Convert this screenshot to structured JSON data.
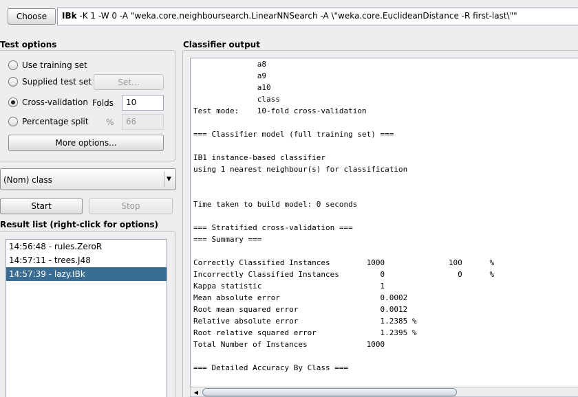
{
  "header": {
    "choose_label": "Choose",
    "command_name": "IBk",
    "command_args": "-K 1 -W 0 -A \"weka.core.neighboursearch.LinearNNSearch -A \\\"weka.core.EuclideanDistance -R first-last\\\"\""
  },
  "test_options": {
    "title": "Test options",
    "use_training_set": "Use training set",
    "supplied_test_set": "Supplied test set",
    "set_label": "Set...",
    "cross_validation": "Cross-validation",
    "folds_label": "Folds",
    "folds_value": "10",
    "percentage_split": "Percentage split",
    "percent_symbol": "%",
    "percentage_value": "66",
    "more_options": "More options...",
    "selected": "cross-validation"
  },
  "class_select": {
    "value": "(Nom) class",
    "arrow": "▼"
  },
  "run": {
    "start_label": "Start",
    "stop_label": "Stop"
  },
  "result_list": {
    "title": "Result list (right-click for options)",
    "items": [
      {
        "label": "14:56:48 - rules.ZeroR",
        "selected": false
      },
      {
        "label": "14:57:11 - trees.J48",
        "selected": false
      },
      {
        "label": "14:57:39 - lazy.IBk",
        "selected": true
      }
    ]
  },
  "classifier_output": {
    "title": "Classifier output",
    "text": "              a8\n              a9\n              a10\n              class\nTest mode:    10-fold cross-validation\n\n=== Classifier model (full training set) ===\n\nIB1 instance-based classifier\nusing 1 nearest neighbour(s) for classification\n\n\nTime taken to build model: 0 seconds\n\n=== Stratified cross-validation ===\n=== Summary ===\n\nCorrectly Classified Instances        1000              100      %\nIncorrectly Classified Instances         0                0      %\nKappa statistic                          1\nMean absolute error                      0.0002\nRoot mean squared error                  0.0012\nRelative absolute error                  1.2385 %\nRoot relative squared error              1.2395 %\nTotal Number of Instances             1000\n\n=== Detailed Accuracy By Class ==="
  },
  "scroll": {
    "left_arrow": "◀"
  }
}
